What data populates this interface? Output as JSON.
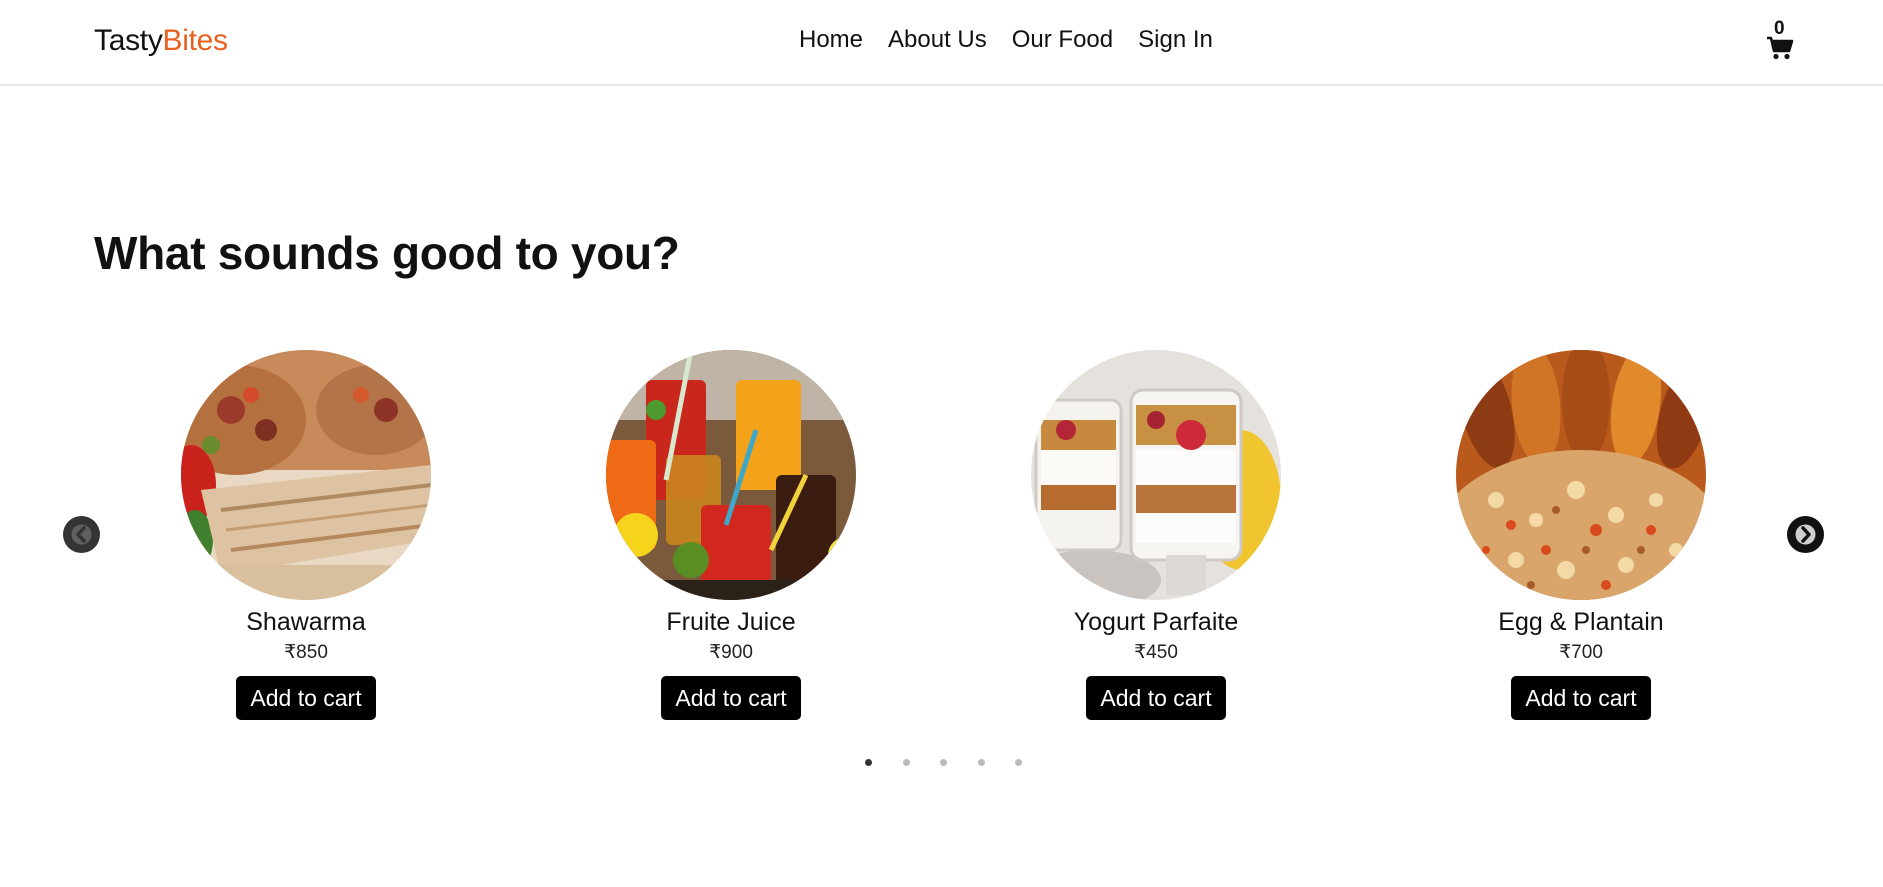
{
  "header": {
    "logo_part1": "Tasty",
    "logo_part2": "Bites",
    "nav": [
      "Home",
      "About Us",
      "Our Food",
      "Sign In"
    ],
    "cart_count": "0",
    "cart_icon": "shopping-cart-icon"
  },
  "main": {
    "title": "What sounds good to you?",
    "carousel": {
      "items": [
        {
          "name": "Shawarma",
          "price": "₹850",
          "button": "Add to cart"
        },
        {
          "name": "Fruite Juice",
          "price": "₹900",
          "button": "Add to cart"
        },
        {
          "name": "Yogurt Parfaite",
          "price": "₹450",
          "button": "Add to cart"
        },
        {
          "name": "Egg & Plantain",
          "price": "₹700",
          "button": "Add to cart"
        }
      ],
      "prev_icon": "chevron-left-icon",
      "next_icon": "chevron-right-icon",
      "page_count": 5,
      "active_page": 1
    }
  },
  "colors": {
    "accent": "#e8621f",
    "button_bg": "#000000",
    "button_text": "#ffffff"
  }
}
